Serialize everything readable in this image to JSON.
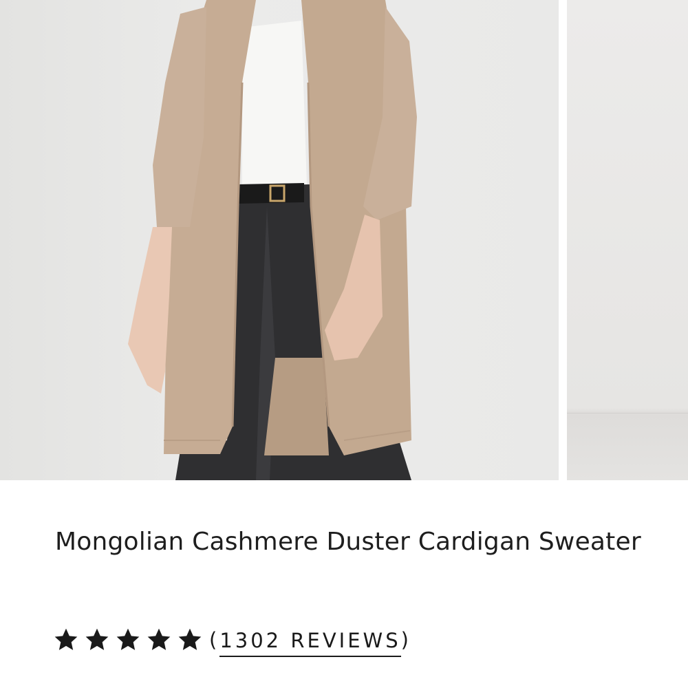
{
  "product": {
    "title": "Mongolian Cashmere Duster Cardigan Sweater"
  },
  "gallery": {
    "images": [
      {
        "icon": "product-photo-model-cardigan"
      },
      {
        "icon": "product-photo-next-partial"
      }
    ]
  },
  "rating": {
    "stars": 5,
    "open_paren": "(",
    "reviews_label": "1302 REVIEWS",
    "close_paren": ")"
  },
  "colors": {
    "text": "#1a1a1a",
    "cardigan": "#c4ab93",
    "background": "#ffffff"
  }
}
